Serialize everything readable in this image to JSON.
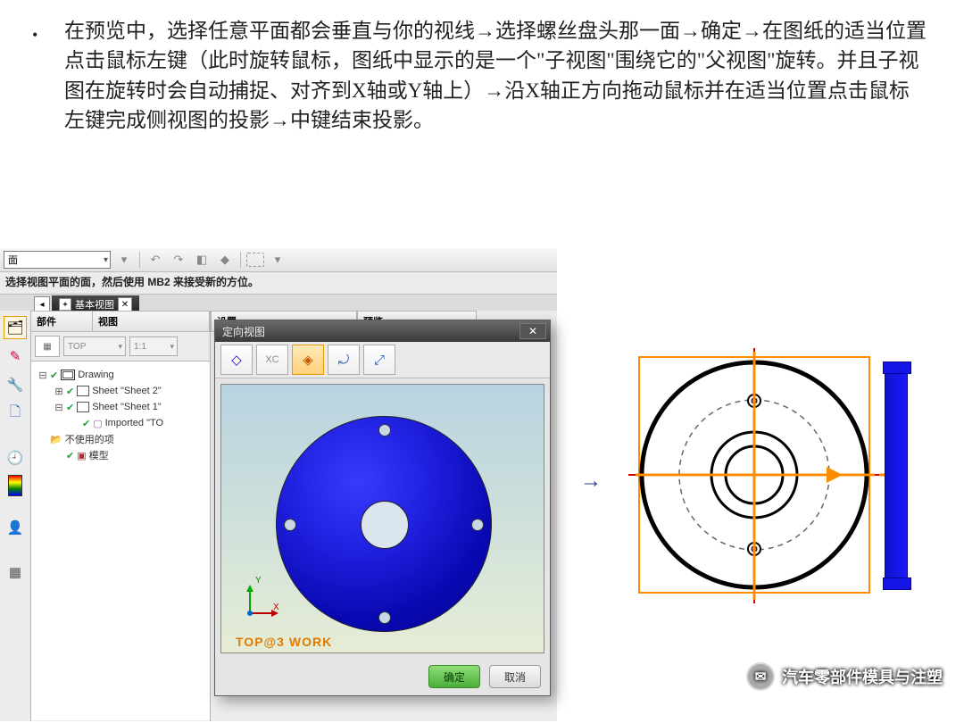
{
  "instruction": "在预览中，选择任意平面都会垂直与你的视线→选择螺丝盘头那一面→确定→在图纸的适当位置点击鼠标左键（此时旋转鼠标，图纸中显示的是一个\"子视图\"围绕它的\"父视图\"旋转。并且子视图在旋转时会自动捕捉、对齐到X轴或Y轴上）→沿X轴正方向拖动鼠标并在适当位置点击鼠标左键完成侧视图的投影→中键结束投影。",
  "nx": {
    "combo": "面",
    "hint": "选择视图平面的面，然后使用 MB2 来接受新的方位。",
    "tab": "基本视图",
    "panel": {
      "h_part": "部件",
      "h_view": "视图",
      "view_combo": "TOP",
      "scale_combo": "1:1"
    },
    "tree": {
      "root": "Drawing",
      "s2": "Sheet \"Sheet 2\"",
      "s1": "Sheet \"Sheet 1\"",
      "imp": "Imported \"TO",
      "unused": "不使用的项",
      "model": "模型"
    },
    "content": {
      "h1": "设置",
      "h2": "预览"
    }
  },
  "dlg": {
    "title": "定向视图",
    "xc_label": "XC",
    "view_label": "TOP@3 WORK",
    "ok": "确定",
    "cancel": "取消"
  },
  "arrow": "→",
  "watermark": "汽车零部件模具与注塑"
}
